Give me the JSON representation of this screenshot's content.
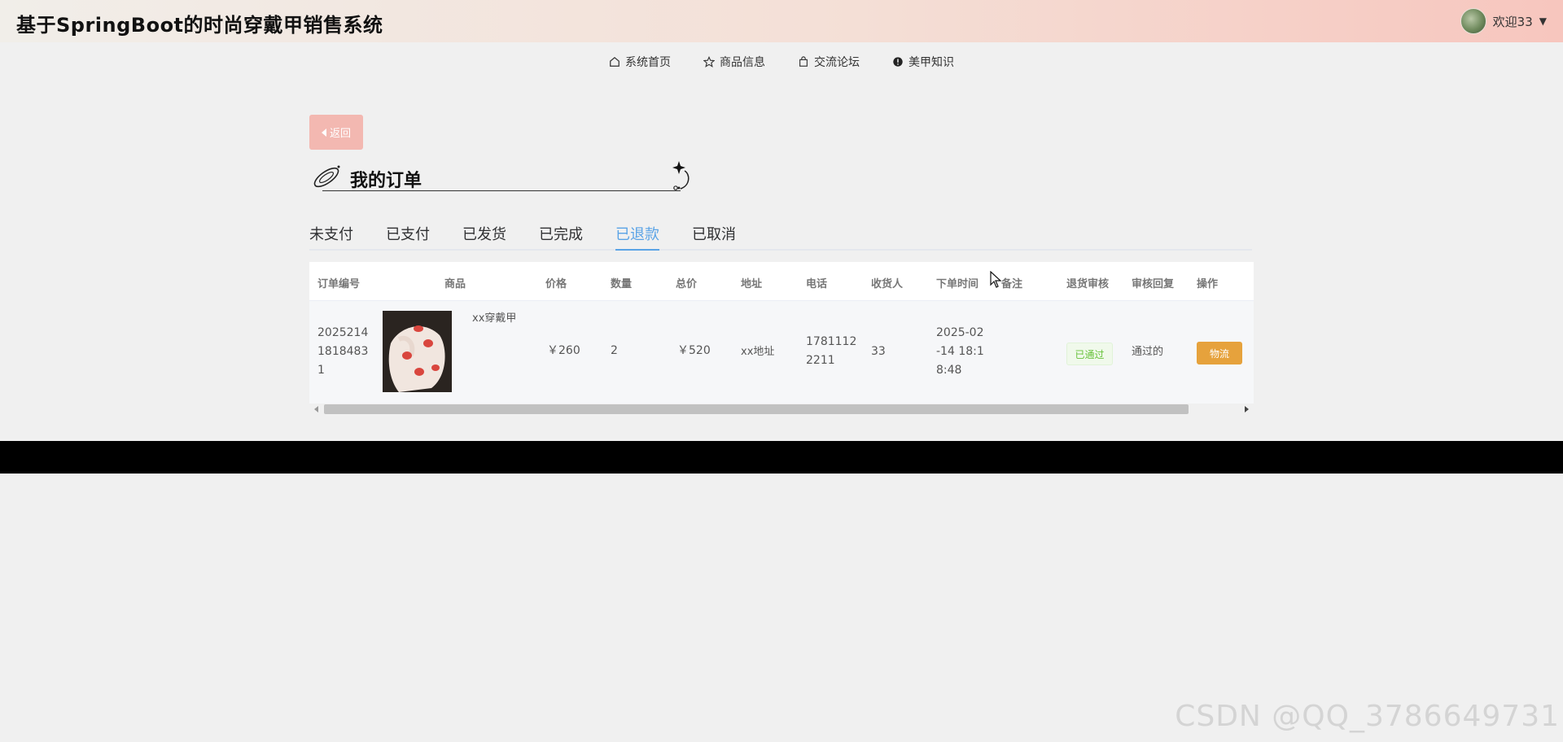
{
  "header": {
    "site_title": "基于SpringBoot的时尚穿戴甲销售系统",
    "welcome": "欢迎33",
    "caret": "▼"
  },
  "nav": {
    "items": [
      {
        "label": "系统首页",
        "icon": "home-icon"
      },
      {
        "label": "商品信息",
        "icon": "star-icon"
      },
      {
        "label": "交流论坛",
        "icon": "shopping-bag-icon"
      },
      {
        "label": "美甲知识",
        "icon": "info-icon"
      }
    ]
  },
  "back_button": {
    "label": "返回"
  },
  "page_heading": "我的订单",
  "tabs": [
    "未支付",
    "已支付",
    "已发货",
    "已完成",
    "已退款",
    "已取消"
  ],
  "active_tab": "已退款",
  "table": {
    "columns": [
      "订单编号",
      "商品",
      "价格",
      "数量",
      "总价",
      "地址",
      "电话",
      "收货人",
      "下单时间",
      "备注",
      "退货审核",
      "审核回复",
      "操作"
    ],
    "rows": [
      {
        "order_no_lines": [
          "2025214",
          "1818483",
          "1"
        ],
        "product_name": "xx穿戴甲",
        "price": "￥260",
        "quantity": "2",
        "total": "￥520",
        "address": "xx地址",
        "phone_lines": [
          "1781112",
          "2211"
        ],
        "receiver": "33",
        "order_time_lines": [
          "2025-02",
          "-14 18:1",
          "8:48"
        ],
        "remark": "",
        "return_review": "已通过",
        "review_reply": "通过的",
        "action": "物流"
      }
    ]
  },
  "colors": {
    "accent_blue": "#5aa3e6",
    "back_button": "#f3b8b1",
    "logistics_button": "#e6a23c",
    "badge_green": "#67c23a"
  },
  "watermark": "CSDN @QQ_3786649731"
}
